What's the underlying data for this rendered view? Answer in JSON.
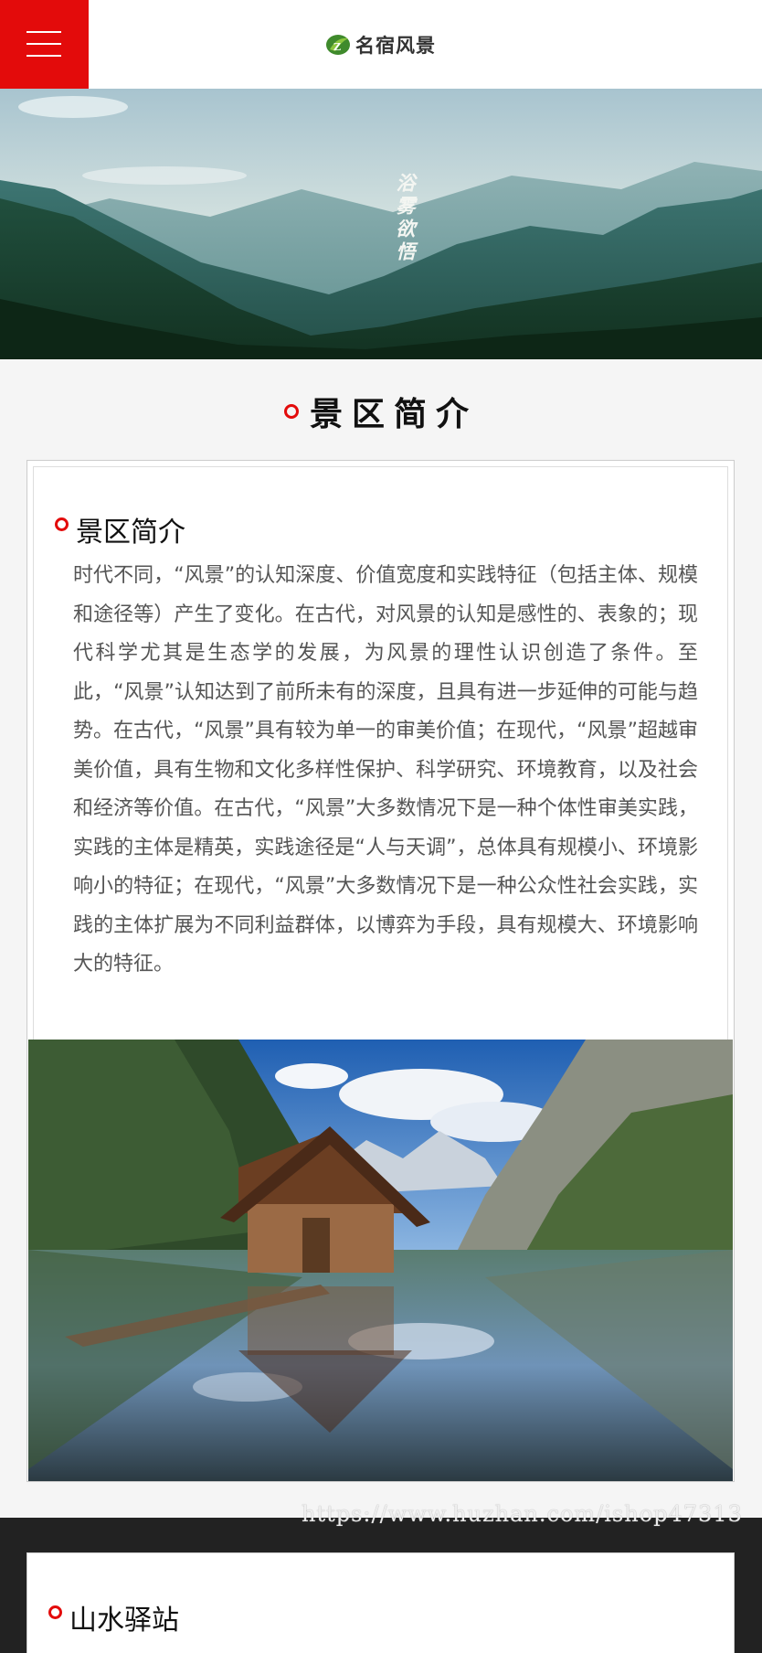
{
  "header": {
    "logo_text": "名宿风景",
    "logo_icon": "leaf-logo-icon",
    "menu_icon": "hamburger-menu-icon",
    "brand_color": "#e30b0b"
  },
  "banner": {
    "title": "浴雾欲悟",
    "subtitle_a": "",
    "subtitle_b": ""
  },
  "section": {
    "heading": "景区简介"
  },
  "intro_card": {
    "title": "景区简介",
    "body": "时代不同，“风景”的认知深度、价值宽度和实践特征（包括主体、规模和途径等）产生了变化。在古代，对风景的认知是感性的、表象的；现代科学尤其是生态学的发展，为风景的理性认识创造了条件。至此，“风景”认知达到了前所未有的深度，且具有进一步延伸的可能与趋势。在古代，“风景”具有较为单一的审美价值；在现代，“风景”超越审美价值，具有生物和文化多样性保护、科学研究、环境教育，以及社会和经济等价值。在古代，“风景”大多数情况下是一种个体性审美实践，实践的主体是精英，实践途径是“人与天调”，总体具有规模小、环境影响小的特征；在现代，“风景”大多数情况下是一种公众性社会实践，实践的主体扩展为不同利益群体，以博弈为手段，具有规模大、环境影响大的特征。"
  },
  "watermark": "https://www.huzhan.com/ishop47313",
  "second_card": {
    "title": "山水驿站"
  }
}
